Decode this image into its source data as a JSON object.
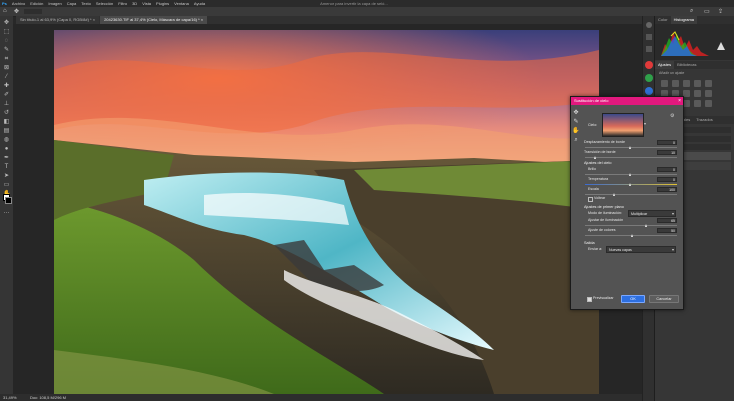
{
  "menubar": {
    "items": [
      "Archivo",
      "Edición",
      "Imagen",
      "Capa",
      "Texto",
      "Selección",
      "Filtro",
      "3D",
      "Vista",
      "Plugins",
      "Ventana",
      "Ayuda"
    ],
    "notice": "Amenor para invertir la capa de seló..."
  },
  "document_tabs": [
    {
      "label": "Sin título-1 al 63,9% (Capa 0, RGB/8#) *",
      "close": "×"
    },
    {
      "label": "20423630.TIF al 37,4% (Cielo, Máscara de capa/16) *",
      "close": "×"
    }
  ],
  "status": {
    "zoom": "31,49%",
    "doc_info": "Doc: 108,5 M/296 M"
  },
  "right_panels": {
    "top_tabs": [
      "Color",
      "Histograma"
    ],
    "adjust_tabs": [
      "Ajustes",
      "Bibliotecas"
    ],
    "adjust_subtitle": "Añadir un ajuste",
    "layers_tab": "Capas",
    "channels_tab": "Canales",
    "paths_tab": "Trazados"
  },
  "dialog": {
    "title": "Sustitución de cielo",
    "close": "×",
    "sky_label": "Cielo:",
    "fields": {
      "shift_edge": {
        "label": "Desplazamiento de borde",
        "value": "0"
      },
      "fade_edge": {
        "label": "Transición de borde",
        "value": "10"
      },
      "sky_adjust_title": "Ajustes del cielo",
      "brightness": {
        "label": "Brillo",
        "value": "0"
      },
      "temperature": {
        "label": "Temperatura",
        "value": "0"
      },
      "scale": {
        "label": "Escala",
        "value": "100"
      },
      "flip": {
        "label": "Voltear"
      },
      "foreground_title": "Ajustes de primer plano",
      "lighting_mode": {
        "label": "Modo de iluminación:",
        "value": "Multiplicar"
      },
      "lighting_adjust": {
        "label": "Ajustar de iluminación",
        "value": "65"
      },
      "color_adjust": {
        "label": "Ajuste de colores",
        "value": "50"
      },
      "output_title": "Salida",
      "output_to": {
        "label": "Enviar a:",
        "value": "Nuevas capas"
      }
    },
    "preview_label": "Previsualizar",
    "ok_label": "OK",
    "cancel_label": "Cancelar"
  },
  "colors": {
    "accent": "#e2197e",
    "panel": "#363636",
    "app_bg": "#282828",
    "dialog_bg": "#535353"
  }
}
